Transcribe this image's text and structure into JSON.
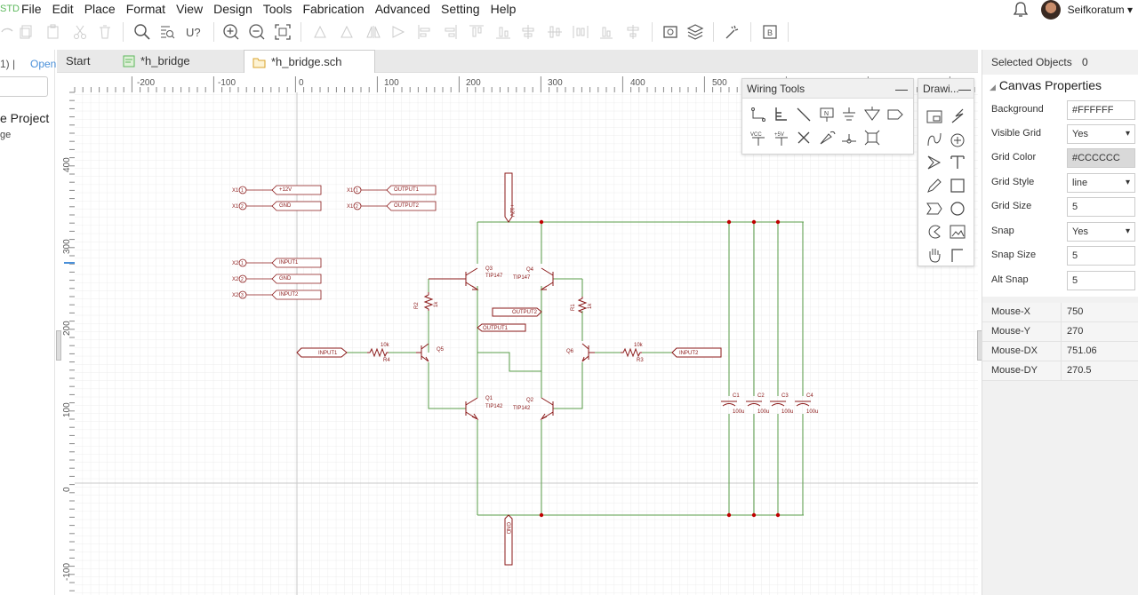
{
  "app": {
    "logo_fragment": "STD"
  },
  "menu": [
    "File",
    "Edit",
    "Place",
    "Format",
    "View",
    "Design",
    "Tools",
    "Fabrication",
    "Advanced",
    "Setting",
    "Help"
  ],
  "user": {
    "name": "Seifkoratum ▾"
  },
  "left_panel": {
    "count_fragment": "1)  |",
    "open_label": "Open",
    "project_fragment": "e Project",
    "sub_fragment": "ge"
  },
  "tabs": [
    {
      "label": "Start",
      "icon": "none",
      "active": false
    },
    {
      "label": "*h_bridge",
      "icon": "pcb-icon",
      "active": false
    },
    {
      "label": "*h_bridge.sch",
      "icon": "folder-icon",
      "active": true
    }
  ],
  "ruler": {
    "x_labels": [
      "-200",
      "-100",
      "0",
      "100",
      "200",
      "300",
      "400",
      "500"
    ],
    "y_labels": [
      "400",
      "300",
      "200",
      "100",
      "0",
      "-100"
    ]
  },
  "schematic": {
    "net_labels": {
      "p12": "+12V",
      "gnd1": "GND",
      "out1": "OUTPUT1",
      "out2": "OUTPUT2",
      "in1": "INPUT1",
      "gnd2": "GND",
      "in2": "INPUT2",
      "in1_main": "INPUT1",
      "in2_main": "INPUT2",
      "out2_mid": "OUTPUT2",
      "out1_mid": "OUTPUT1",
      "v12_top": "+12V",
      "gnd_bottom": "GND"
    },
    "connector_refs": [
      "X1",
      "X1",
      "X1",
      "X1",
      "X2",
      "X2",
      "X2"
    ],
    "connector_pins": [
      "1",
      "2",
      "1",
      "2",
      "1",
      "2",
      "3"
    ],
    "transistors": {
      "q3": "Q3",
      "q3v": "TIP147",
      "q4": "Q4",
      "q4v": "TIP147",
      "q1": "Q1",
      "q1v": "TIP142",
      "q2": "Q2",
      "q2v": "TIP142",
      "q5": "Q5",
      "q6": "Q6"
    },
    "resistors": {
      "r2": "R2",
      "r2v": "1k",
      "r1": "R1",
      "r1v": "1k",
      "r4": "R4",
      "r4v": "10k",
      "r3": "R3",
      "r3v": "10k"
    },
    "capacitors": [
      {
        "ref": "C1",
        "value": "100u"
      },
      {
        "ref": "C2",
        "value": "100u"
      },
      {
        "ref": "C3",
        "value": "100u"
      },
      {
        "ref": "C4",
        "value": "100u"
      }
    ]
  },
  "wiring_tools": {
    "title": "Wiring Tools",
    "minimize": "—",
    "icons": [
      "wire-icon",
      "bus-icon",
      "bus-entry-icon",
      "net-label-icon",
      "ground-icon",
      "net-port-icon",
      "netflag-icon",
      "vcc-icon",
      "plus5v-icon",
      "no-connect-icon",
      "pin-icon",
      "pin-connector-icon",
      "net-group-icon"
    ],
    "vcc_text": "VCC",
    "plus5_text": "+5V"
  },
  "drawing_tools": {
    "title": "Drawi...",
    "minimize": "—",
    "icons": [
      "image-icon",
      "lightning-icon",
      "bezier-icon",
      "arc-icon",
      "arrowhead-icon",
      "text-icon",
      "freehand-icon",
      "rectangle-icon",
      "polygon-icon",
      "ellipse-icon",
      "pie-icon",
      "image-frame-icon",
      "pan-icon",
      "line-icon"
    ]
  },
  "right_panel": {
    "selected_label": "Selected Objects",
    "selected_value": "0",
    "canvas_title": "Canvas Properties",
    "properties": [
      {
        "label": "Background",
        "value": "#FFFFFF",
        "type": "text"
      },
      {
        "label": "Visible Grid",
        "value": "Yes",
        "type": "select"
      },
      {
        "label": "Grid Color",
        "value": "#CCCCCC",
        "type": "color"
      },
      {
        "label": "Grid Style",
        "value": "line",
        "type": "select"
      },
      {
        "label": "Grid Size",
        "value": "5",
        "type": "text"
      },
      {
        "label": "Snap",
        "value": "Yes",
        "type": "select"
      },
      {
        "label": "Snap Size",
        "value": "5",
        "type": "text"
      },
      {
        "label": "Alt Snap",
        "value": "5",
        "type": "text"
      }
    ],
    "mouse": [
      {
        "label": "Mouse-X",
        "value": "750"
      },
      {
        "label": "Mouse-Y",
        "value": "270"
      },
      {
        "label": "Mouse-DX",
        "value": "751.06"
      },
      {
        "label": "Mouse-DY",
        "value": "270.5"
      }
    ]
  },
  "colors": {
    "wire": "#5a9e4a",
    "part": "#8b1a1a",
    "grid": "#e8e8e8",
    "accent": "#4a90d9"
  }
}
